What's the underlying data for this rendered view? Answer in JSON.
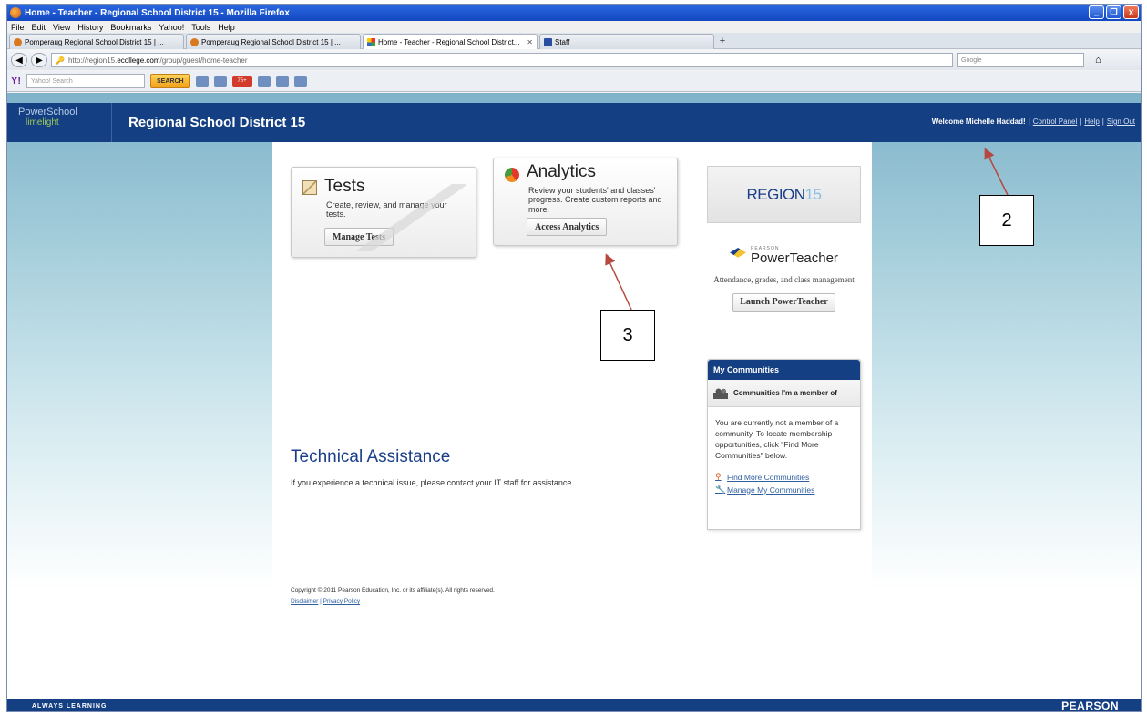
{
  "window": {
    "title": "Home - Teacher - Regional School District 15 - Mozilla Firefox",
    "controls": [
      "_",
      "❐",
      "X"
    ]
  },
  "menu": [
    "File",
    "Edit",
    "View",
    "History",
    "Bookmarks",
    "Yahoo!",
    "Tools",
    "Help"
  ],
  "tabs": [
    {
      "label": "Pomperaug Regional School District 15 | ...",
      "icon": "firefox-icon"
    },
    {
      "label": "Pomperaug Regional School District 15 | ...",
      "icon": "firefox-icon"
    },
    {
      "label": "Home - Teacher - Regional School District...",
      "icon": "grid-icon",
      "active": true
    },
    {
      "label": "Staff",
      "icon": "staff-icon"
    }
  ],
  "nav": {
    "url_prefix": "http://region15.",
    "url_domain": "ecollege.com",
    "url_path": "/group/guest/home-teacher",
    "search_placeholder": "Google"
  },
  "yahoo": {
    "logo": "Y!",
    "search_placeholder": "Yahoo! Search",
    "search_button": "SEARCH",
    "mail_badge": "75+"
  },
  "header": {
    "logo_top": "PowerSchool",
    "logo_bottom": "limelight",
    "district": "Regional School District 15",
    "welcome": "Welcome Michelle Haddad!",
    "control_panel": "Control Panel",
    "help": "Help",
    "sign_out": "Sign Out",
    "sep": "|"
  },
  "cards": {
    "tests": {
      "title": "Tests",
      "desc": "Create, review, and manage your tests.",
      "button": "Manage Tests"
    },
    "analytics": {
      "title": "Analytics",
      "desc": "Review your students' and classes' progress. Create custom reports and more.",
      "button": "Access Analytics"
    }
  },
  "region": {
    "text": "REGION",
    "num": "15"
  },
  "powerteacher": {
    "brand": "PEARSON",
    "name": "PowerTeacher",
    "desc": "Attendance, grades, and class management",
    "button": "Launch PowerTeacher"
  },
  "communities": {
    "header": "My Communities",
    "sub": "Communities I'm a member of",
    "body": "You are currently not a member of a community. To locate membership opportunities, click \"Find More Communities\" below.",
    "find": "Find More Communities",
    "manage": "Manage My Communities"
  },
  "tech": {
    "title": "Technical Assistance",
    "text": "If you experience a technical issue, please contact your IT staff for assistance."
  },
  "copyright": "Copyright © 2011 Pearson Education, Inc. or its affiliate(s). All rights reserved.",
  "footer_links": {
    "disclaimer": "Disclaimer",
    "sep": "|",
    "privacy": "Privacy Policy"
  },
  "footer": {
    "left": "ALWAYS LEARNING",
    "right": "PEARSON"
  },
  "annotations": [
    {
      "label": "2"
    },
    {
      "label": "3"
    }
  ],
  "colors": {
    "brand_blue": "#153f83",
    "annotation_arrow": "#b5483f"
  }
}
